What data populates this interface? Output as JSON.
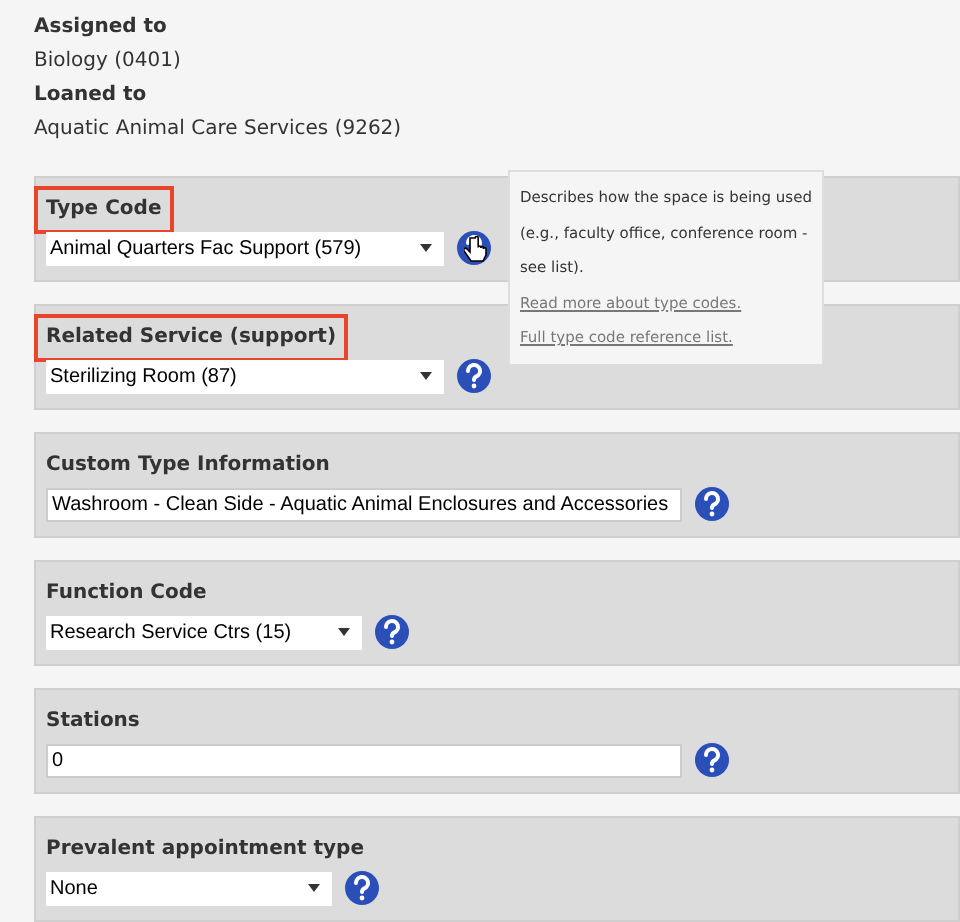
{
  "info": [
    {
      "label": "Assigned to",
      "value": "Biology (0401)"
    },
    {
      "label": "Loaned to",
      "value": "Aquatic Animal Care Services (9262)"
    }
  ],
  "fields": [
    {
      "label": "Type Code",
      "highlighted": true,
      "kind": "select",
      "value": "Animal Quarters Fac Support (579)"
    },
    {
      "label": "Related Service (support)",
      "highlighted": true,
      "kind": "select",
      "value": "Sterilizing Room (87)"
    },
    {
      "label": "Custom Type Information",
      "highlighted": false,
      "kind": "text",
      "value": "Washroom - Clean Side - Aquatic Animal Enclosures and Accessories"
    },
    {
      "label": "Function Code",
      "highlighted": false,
      "kind": "select",
      "value": "Research Service Ctrs (15)"
    },
    {
      "label": "Stations",
      "highlighted": false,
      "kind": "text",
      "value": "0"
    },
    {
      "label": "Prevalent appointment type",
      "highlighted": false,
      "kind": "select",
      "value": "None"
    }
  ],
  "tooltip": {
    "text": "Describes how the space is being used (e.g., faculty office, conference room - see list).",
    "links": [
      "Read more about type codes.",
      "Full type code reference list."
    ]
  }
}
